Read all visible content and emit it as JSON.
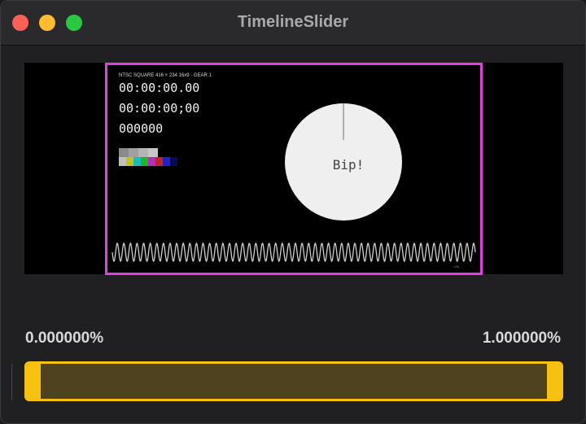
{
  "window": {
    "title": "TimelineSlider"
  },
  "video": {
    "info_line": "NTSC SQUARE  416 × 234  16x9  ·  GEAR 1",
    "timecode_1": "00:00:00.00",
    "timecode_2": "00:00:00;00",
    "frame_counter": "000000",
    "circle_text": "Bip!",
    "corner_mark": "¹⁰⁸",
    "frame_border_color": "#e33ee6"
  },
  "slider": {
    "start_label": "0.000000%",
    "end_label": "1.000000%",
    "start_value": 0.0,
    "end_value": 1.0,
    "accent_color": "#f6c20f",
    "fill_color": "#4f431f"
  }
}
